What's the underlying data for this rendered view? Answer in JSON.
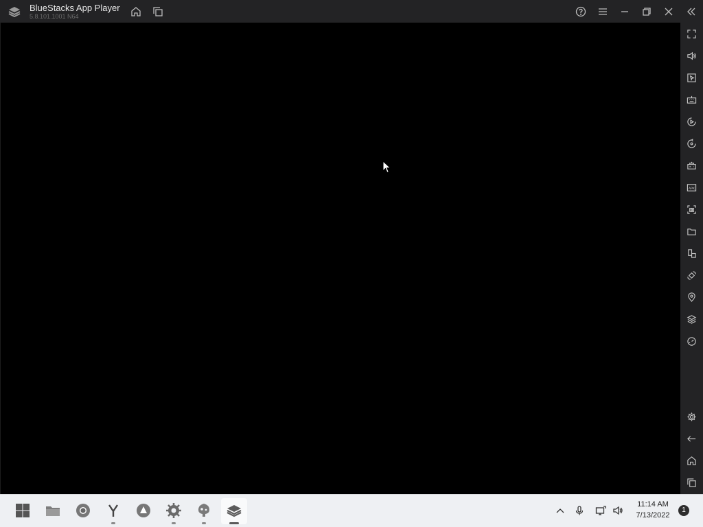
{
  "window": {
    "title": "BlueStacks App Player",
    "version": "5.8.101.1001 N64"
  },
  "titlebar_buttons": [
    "home-icon",
    "multi-instance-icon",
    "help-icon",
    "menu-icon",
    "minimize-icon",
    "restore-icon",
    "close-icon",
    "collapse-sidebar-icon"
  ],
  "sidebar_tools": [
    "fullscreen-icon",
    "volume-icon",
    "pointer-icon",
    "keyboard-icon",
    "macro-play-icon",
    "sync-icon",
    "gamepad-icon",
    "apk-install-icon",
    "screenshot-icon",
    "folder-icon",
    "multi-instance-icon",
    "rotate-icon",
    "location-icon",
    "layers-icon",
    "performance-icon"
  ],
  "sidebar_bottom": [
    "settings-icon",
    "back-icon",
    "home-icon",
    "recent-apps-icon"
  ],
  "taskbar": {
    "apps": [
      "start-icon",
      "file-explorer-icon",
      "chrome-icon",
      "yandex-icon",
      "alice-icon",
      "settings-icon",
      "inkscape-icon",
      "bluestacks-icon"
    ]
  },
  "tray": {
    "time": "11:14 AM",
    "date": "7/13/2022",
    "notifications": "1"
  },
  "colors": {
    "titlebar": "#232325",
    "viewport": "#000000",
    "taskbar": "#eef0f3"
  }
}
